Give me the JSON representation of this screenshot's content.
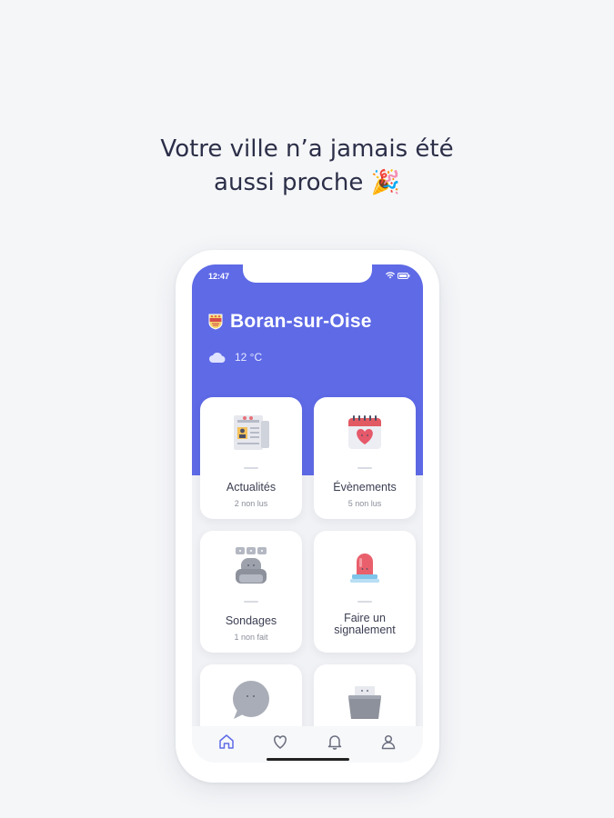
{
  "headline": {
    "line1": "Votre ville n’a jamais été",
    "line2": "aussi proche 🎉"
  },
  "status_bar": {
    "time": "12:47"
  },
  "city": {
    "name": "Boran-sur-Oise",
    "crest_icon": "city-crest-icon"
  },
  "weather": {
    "icon": "cloud-icon",
    "temperature": "12 °C"
  },
  "cards": [
    {
      "title": "Actualités",
      "subtitle": "2 non lus",
      "icon": "newspaper-icon"
    },
    {
      "title": "Évènements",
      "subtitle": "5 non lus",
      "icon": "calendar-heart-icon"
    },
    {
      "title": "Sondages",
      "subtitle": "1 non fait",
      "icon": "poll-icon"
    },
    {
      "title": "Faire un signalement",
      "subtitle": "",
      "icon": "alarm-light-icon"
    },
    {
      "title": "",
      "subtitle": "",
      "icon": "chat-bubble-icon"
    },
    {
      "title": "",
      "subtitle": "",
      "icon": "folder-icon"
    }
  ],
  "tabbar": {
    "items": [
      {
        "icon": "home-icon",
        "active": true
      },
      {
        "icon": "heart-icon",
        "active": false
      },
      {
        "icon": "bell-icon",
        "active": false
      },
      {
        "icon": "user-icon",
        "active": false
      }
    ]
  },
  "colors": {
    "accent": "#5e6ae6",
    "background": "#f5f6f8",
    "text": "#2c2f48"
  }
}
